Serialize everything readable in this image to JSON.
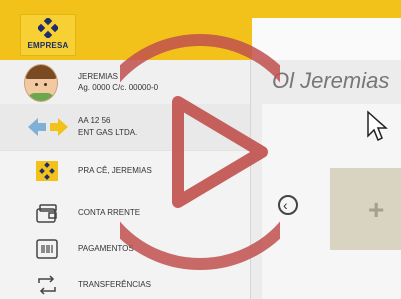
{
  "brand": {
    "logo_text": "EMPRESA"
  },
  "user": {
    "name": "JEREMIAS",
    "account": "Ag. 0000 C/c. 00000-0"
  },
  "company": {
    "code": "AA 12 56",
    "name": "ENT GAS LTDA."
  },
  "nav": [
    {
      "label": "PRA  CÊ, JEREMIAS",
      "icon": "bank-logo-icon"
    },
    {
      "label": "CONTA  RRENTE",
      "icon": "wallet-icon"
    },
    {
      "label": "PAGAMENTOS",
      "icon": "barcode-icon"
    },
    {
      "label": "TRANSFERÊNCIAS",
      "icon": "transfer-arrows-icon"
    }
  ],
  "main": {
    "greeting": "Ol  Jeremias"
  },
  "colors": {
    "brand_yellow": "#f3c21a",
    "brand_blue": "#1c2d6b",
    "play_red": "#c0504d"
  }
}
